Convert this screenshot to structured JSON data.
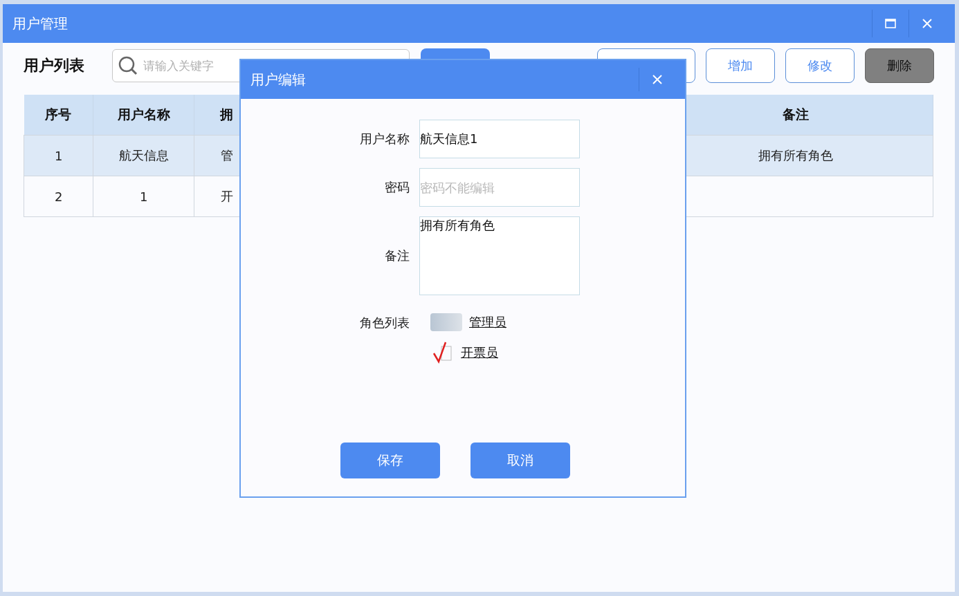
{
  "window": {
    "title": "用户管理"
  },
  "toolbar": {
    "title": "用户列表",
    "search": {
      "placeholder": "请输入关键字"
    },
    "buttons": [
      {
        "kind": "primary"
      },
      {
        "kind": "outline"
      },
      {
        "label": "增加",
        "kind": "outline"
      },
      {
        "label": "修改",
        "kind": "outline"
      },
      {
        "label": "删除",
        "kind": "dark"
      }
    ]
  },
  "table": {
    "columns": [
      "序号",
      "用户名称",
      "拥",
      "备注"
    ],
    "rows": [
      {
        "selected": true,
        "cells": [
          "1",
          "航天信息",
          "管",
          "拥有所有角色"
        ]
      },
      {
        "selected": false,
        "cells": [
          "2",
          "1",
          "开",
          null
        ]
      }
    ]
  },
  "dialog": {
    "title": "用户编辑",
    "fields": [
      {
        "label": "用户名称",
        "kind": "text",
        "value": "航天信息1"
      },
      {
        "label": "密码",
        "kind": "text",
        "placeholder": "密码不能编辑"
      },
      {
        "label": "备注",
        "kind": "textarea",
        "value": "拥有所有角色"
      }
    ],
    "roles_label": "角色列表",
    "roles": [
      {
        "label": "管理员",
        "checked": false
      },
      {
        "label": "开票员",
        "checked": true
      }
    ],
    "buttons": [
      "保存",
      "取消"
    ]
  }
}
